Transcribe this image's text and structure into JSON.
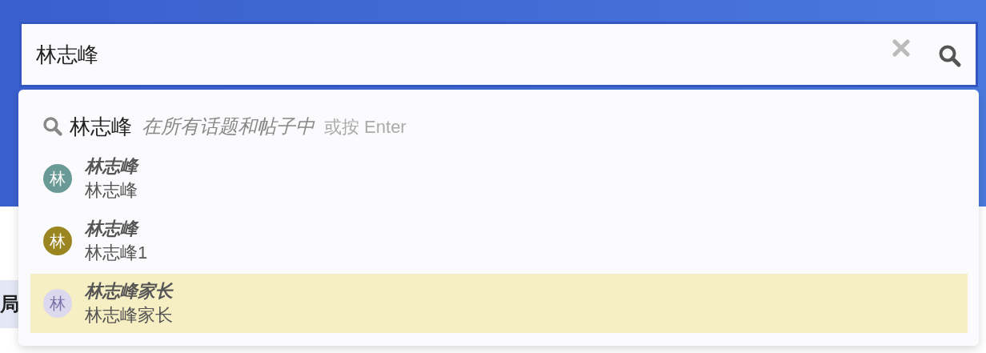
{
  "search": {
    "value": "林志峰"
  },
  "background_text": "局",
  "dropdown": {
    "full_search": {
      "term": "林志峰",
      "scope": "在所有话题和帖子中",
      "hint": "或按 Enter"
    },
    "users": [
      {
        "avatar": "林",
        "color": "#6a9a95",
        "name": "林志峰",
        "username": "林志峰",
        "selected": false
      },
      {
        "avatar": "林",
        "color": "#9a8520",
        "name": "林志峰",
        "username": "林志峰1",
        "selected": false
      },
      {
        "avatar": "林",
        "color": "#dcd8ee",
        "name": "林志峰家长",
        "username": "林志峰家长",
        "selected": true
      }
    ]
  }
}
